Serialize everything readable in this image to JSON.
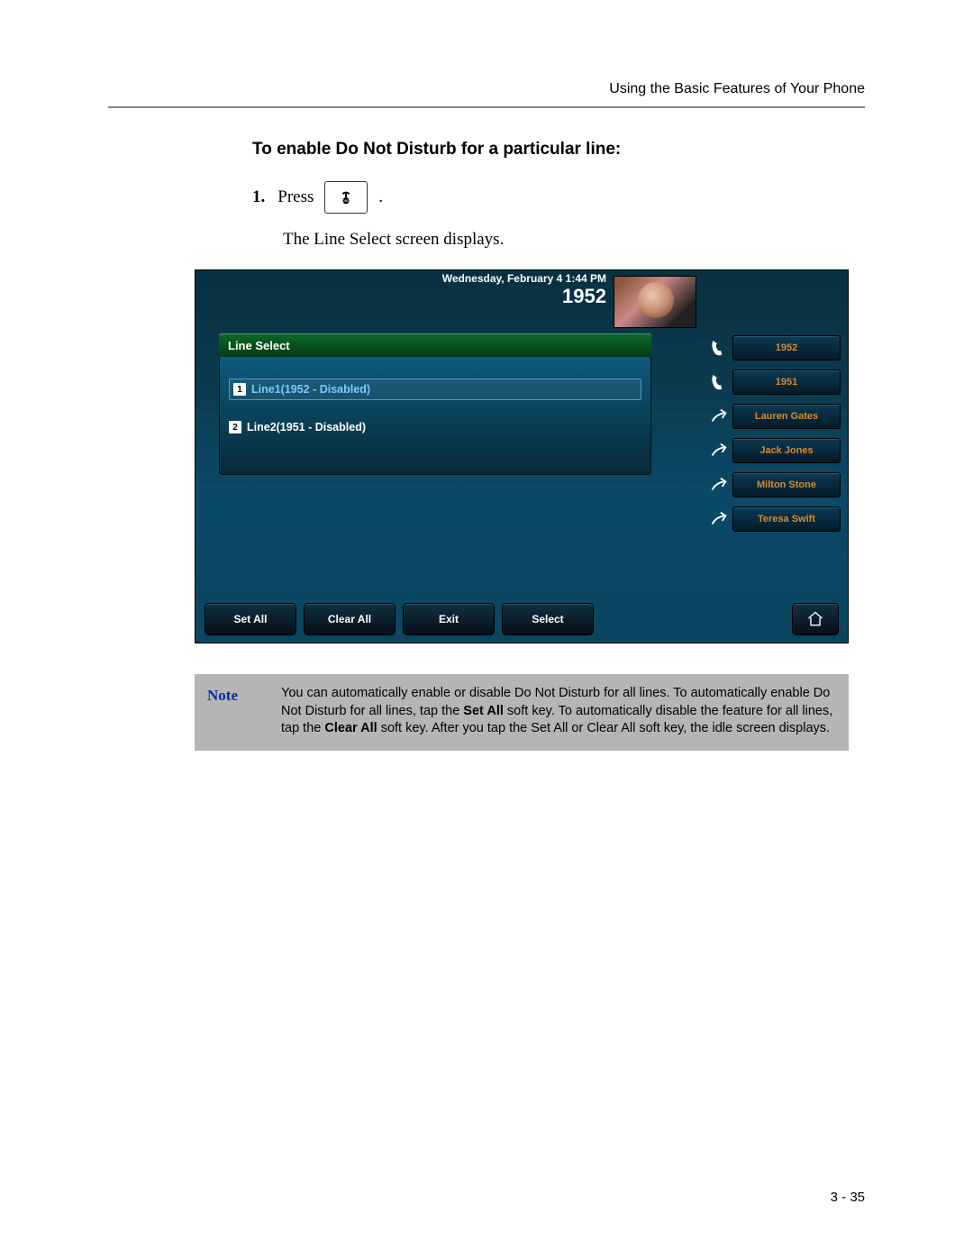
{
  "header": {
    "running": "Using the Basic Features of Your Phone"
  },
  "section": {
    "title": "To enable Do Not Disturb for a particular line:",
    "step_num": "1.",
    "step_word": "Press",
    "step_suffix": ".",
    "subtext": "The Line Select screen displays."
  },
  "screenshot": {
    "datetime": "Wednesday, February 4  1:44 PM",
    "extension": "1952",
    "panel_title": "Line Select",
    "lines": [
      {
        "idx": "1",
        "label": "Line1(1952 - Disabled)"
      },
      {
        "idx": "2",
        "label": "Line2(1951 - Disabled)"
      }
    ],
    "right_keys": [
      {
        "label": "1952"
      },
      {
        "label": "1951"
      },
      {
        "label": "Lauren Gates"
      },
      {
        "label": "Jack Jones"
      },
      {
        "label": "Milton Stone"
      },
      {
        "label": "Teresa Swift"
      }
    ],
    "softkeys": {
      "b0": "Set All",
      "b1": "Clear All",
      "b2": "Exit",
      "b3": "Select"
    }
  },
  "note": {
    "label": "Note",
    "pre": "You can automatically enable or disable Do Not Disturb for all lines. To automatically enable Do Not Disturb for all lines, tap the ",
    "bold1": "Set All",
    "mid1": " soft key. To automatically disable the feature for all lines, tap the ",
    "bold2": "Clear All",
    "post": " soft key. After you tap the Set All or Clear All soft key, the idle screen displays."
  },
  "footer": {
    "page": "3 - 35"
  }
}
